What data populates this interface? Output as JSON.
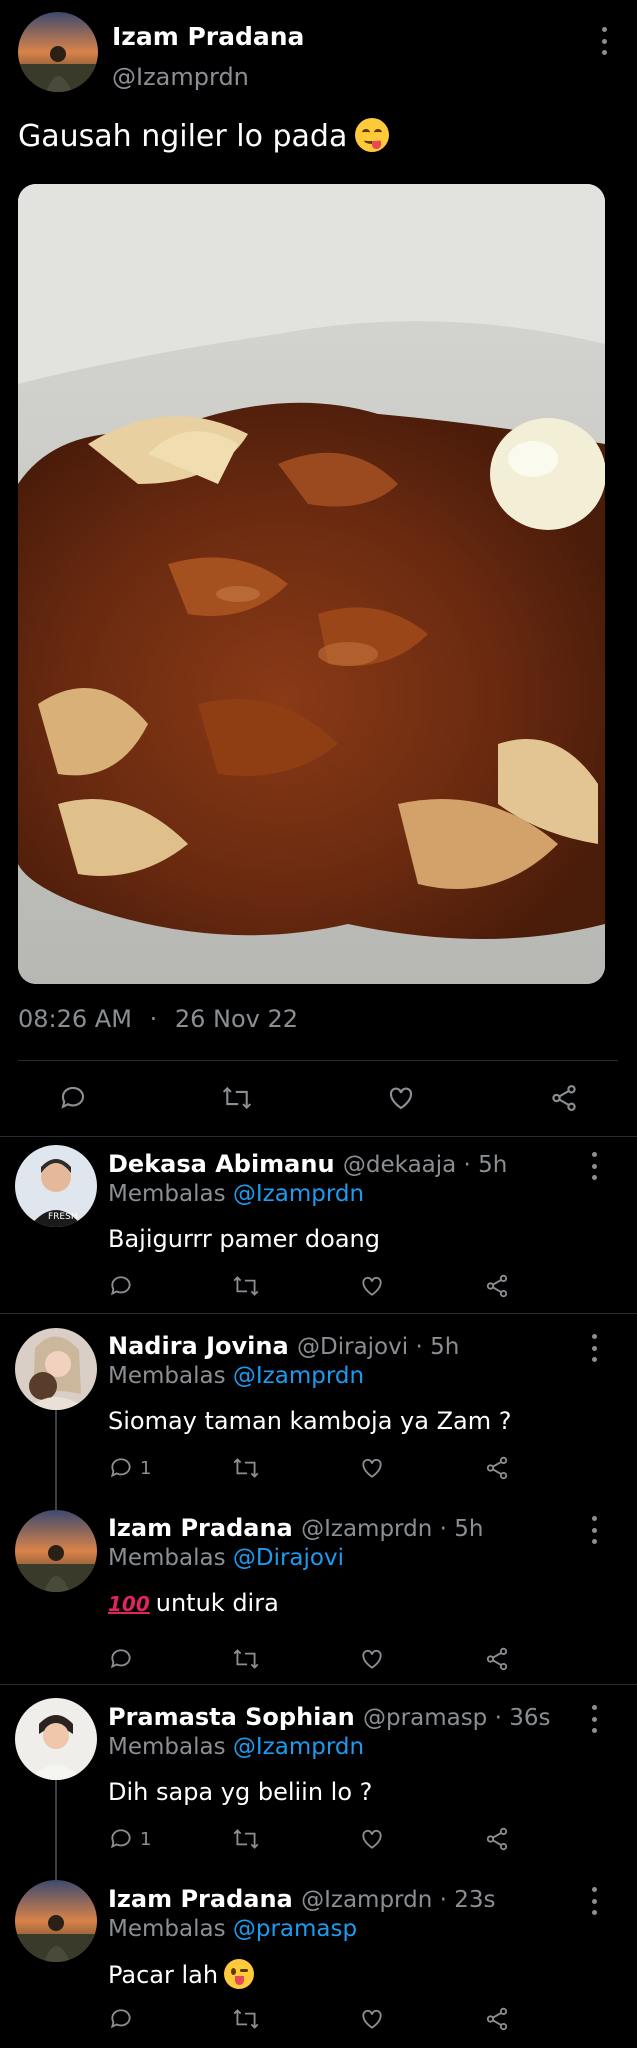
{
  "tweet": {
    "author_name": "Izam Pradana",
    "author_handle": "@Izamprdn",
    "text": "Gausah ngiler lo pada",
    "text_emoji": "yum-face-emoji",
    "time": "08:26 AM",
    "dot": "·",
    "date": "26 Nov 22"
  },
  "actions": [
    "reply-icon",
    "retweet-icon",
    "like-icon",
    "share-icon"
  ],
  "replies": [
    {
      "name": "Dekasa Abimanu",
      "handle": "@dekaaja · 5h",
      "replying_prefix": "Membalas",
      "replying_to": "@Izamprdn",
      "text": "Bajigurrr pamer doang",
      "reply_count": ""
    },
    {
      "name": "Nadira Jovina",
      "handle": "@Dirajovi · 5h",
      "replying_prefix": "Membalas",
      "replying_to": "@Izamprdn",
      "text": "Siomay taman kamboja ya Zam ?",
      "reply_count": "1"
    },
    {
      "name": "Izam Pradana",
      "handle": "@Izamprdn · 5h",
      "replying_prefix": "Membalas",
      "replying_to": "@Dirajovi",
      "text_emoji": "100",
      "text": "untuk dira",
      "reply_count": ""
    },
    {
      "name": "Pramasta Sophian",
      "handle": "@pramasp · 36s",
      "replying_prefix": "Membalas",
      "replying_to": "@Izamprdn",
      "text": "Dih sapa yg beliin lo ?",
      "reply_count": "1"
    },
    {
      "name": "Izam Pradana",
      "handle": "@Izamprdn · 23s",
      "replying_prefix": "Membalas",
      "replying_to": "@pramasp",
      "text": "Pacar lah",
      "text_emoji": "winking-tongue-emoji",
      "reply_count": ""
    }
  ],
  "colors": {
    "background": "#000000",
    "muted": "#8b8f94",
    "mention": "#1d9bf0",
    "divider": "#2a2d30"
  }
}
